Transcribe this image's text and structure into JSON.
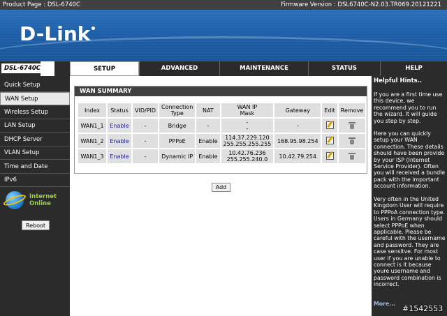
{
  "topbar": {
    "product_page": "Product Page : DSL-6740C",
    "firmware": "Firmware Version :  DSL6740C-N2.03.TR069.20121221"
  },
  "brand": {
    "logo": "D-Link"
  },
  "model": "DSL-6740C",
  "tabs": [
    "SETUP",
    "ADVANCED",
    "MAINTENANCE",
    "STATUS",
    "HELP"
  ],
  "sidebar": {
    "items": [
      "Quick Setup",
      "WAN Setup",
      "Wireless Setup",
      "LAN Setup",
      "DHCP Server",
      "VLAN Setup",
      "Time and Date",
      "IPv6"
    ]
  },
  "status": {
    "line1": "Internet",
    "line2": "Online"
  },
  "reboot_label": "Reboot",
  "wan": {
    "title": "WAN SUMMARY",
    "headers": {
      "index": "Index",
      "status": "Status",
      "vid": "VID/PID",
      "conn1": "Connection",
      "conn2": "Type",
      "nat": "NAT",
      "ip1": "WAN IP",
      "ip2": "Mask",
      "gateway": "Gateway",
      "edit": "Edit",
      "remove": "Remove"
    },
    "rows": [
      {
        "index": "WAN1_1",
        "status": "Enable",
        "vid": "-",
        "type": "Bridge",
        "nat": "-",
        "ip": "-",
        "mask": "-",
        "gateway": "-"
      },
      {
        "index": "WAN1_2",
        "status": "Enable",
        "vid": "-",
        "type": "PPPoE",
        "nat": "Enable",
        "ip": "114.37.229.120",
        "mask": "255.255.255.255",
        "gateway": "168.95.98.254"
      },
      {
        "index": "WAN1_3",
        "status": "Enable",
        "vid": "-",
        "type": "Dynamic IP",
        "nat": "Enable",
        "ip": "10.42.76.236",
        "mask": "255.255.240.0",
        "gateway": "10.42.79.254"
      }
    ],
    "add_label": "Add"
  },
  "hints": {
    "title": "Helpful Hints..",
    "p1": "If you are a first time use this device, we recommend you to run the wizard. It will guide you step by step.",
    "p2": "Here you can quickly setup your WAN connection. These details should have been provide by your ISP (Internet Service Provider). Often you will received a bundle pack with the important account information.",
    "p3": "Very often in the United Kingdom User will require to PPPoA connection type. Users in Germany should select PPPoE when applicable. Please be careful with the username and password. They are case sensitve. For most user if you are unable to connect is it because youre username and password combination is incorrect.",
    "more": "More..."
  },
  "watermark": "#1542553"
}
